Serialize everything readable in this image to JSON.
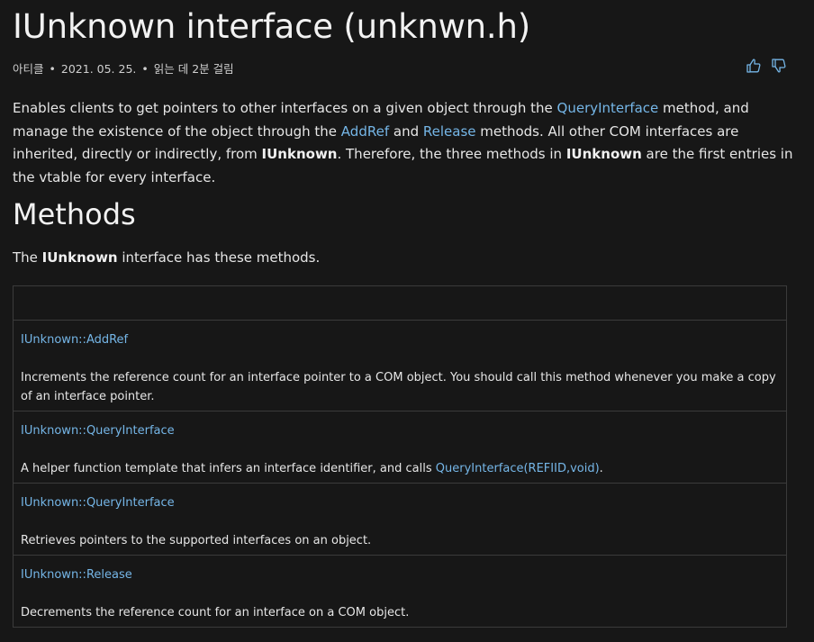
{
  "header": {
    "title": "IUnknown interface (unknwn.h)",
    "meta": {
      "type": "아티클",
      "date": "2021. 05. 25.",
      "read_time": "읽는 데 2분 걸림"
    },
    "feedback": {
      "like_icon": "thumbs-up-icon",
      "dislike_icon": "thumbs-down-icon"
    }
  },
  "intro": {
    "p1": "Enables clients to get pointers to other interfaces on a given object through the ",
    "link_queryinterface": "QueryInterface",
    "p2": " method, and manage the existence of the object through the ",
    "link_addref": "AddRef",
    "p3": " and ",
    "link_release": "Release",
    "p4": " methods. All other COM interfaces are inherited, directly or indirectly, from ",
    "bold1": "IUnknown",
    "p5": ". Therefore, the three methods in ",
    "bold2": "IUnknown",
    "p6": " are the first entries in the vtable for every interface."
  },
  "methods": {
    "heading": "Methods",
    "desc_pre": "The ",
    "desc_bold": "IUnknown",
    "desc_post": " interface has these methods.",
    "rows": [
      {
        "name": "IUnknown::AddRef",
        "desc": "Increments the reference count for an interface pointer to a COM object. You should call this method whenever you make a copy of an interface pointer."
      },
      {
        "name": "IUnknown::QueryInterface",
        "desc_pre": "A helper function template that infers an interface identifier, and calls ",
        "desc_link": "QueryInterface(REFIID,void)",
        "desc_post": "."
      },
      {
        "name": "IUnknown::QueryInterface",
        "desc": "Retrieves pointers to the supported interfaces on an object."
      },
      {
        "name": "IUnknown::Release",
        "desc": "Decrements the reference count for an interface on a COM object."
      }
    ]
  },
  "colors": {
    "background": "#171717",
    "text": "#e6e6e6",
    "link": "#75b6e7",
    "border": "#3b3b3b"
  }
}
